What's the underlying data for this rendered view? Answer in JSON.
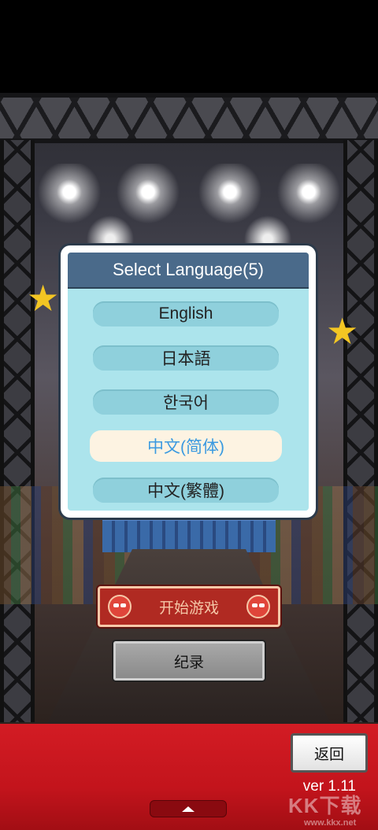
{
  "dialog": {
    "title": "Select Language(5)",
    "options": [
      {
        "label": "English",
        "selected": false
      },
      {
        "label": "日本語",
        "selected": false
      },
      {
        "label": "한국어",
        "selected": false
      },
      {
        "label": "中文(简体)",
        "selected": true
      },
      {
        "label": "中文(繁體)",
        "selected": false
      }
    ]
  },
  "menu": {
    "start_label": "开始游戏",
    "record_label": "纪录"
  },
  "footer": {
    "back_label": "返回",
    "version": "ver 1.11"
  },
  "watermark": {
    "brand": "KK下载",
    "url": "www.kkx.net"
  },
  "colors": {
    "dialog_bg": "#ace4ec",
    "dialog_title_bg": "#4a6a8a",
    "selected_text": "#3a9ae0",
    "footer_red": "#c3141c"
  }
}
